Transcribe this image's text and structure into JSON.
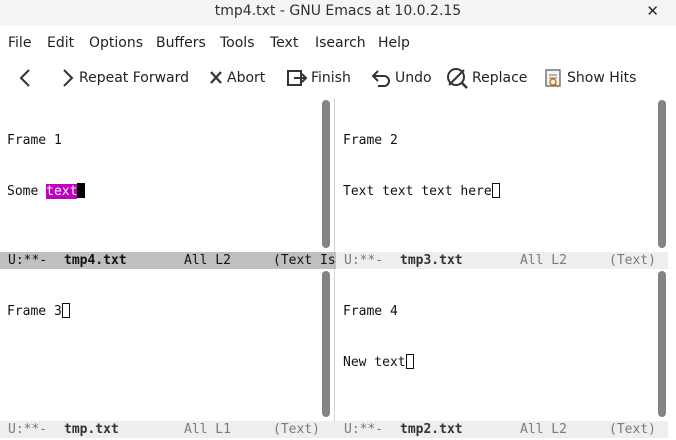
{
  "window": {
    "title": "tmp4.txt - GNU Emacs at 10.0.2.15",
    "close_glyph": "✕"
  },
  "menu": [
    "File",
    "Edit",
    "Options",
    "Buffers",
    "Tools",
    "Text",
    "Isearch",
    "Help"
  ],
  "toolbar": {
    "back_icon": "chevron-left-icon",
    "repeat_forward": "Repeat Forward",
    "abort": "Abort",
    "finish": "Finish",
    "undo": "Undo",
    "replace": "Replace",
    "show_hits": "Show Hits"
  },
  "frames": {
    "f1": {
      "line1": "Frame 1",
      "line2_prefix": "Some ",
      "line2_match": "text"
    },
    "f2": {
      "line1": "Frame 2",
      "line2": "Text text text here"
    },
    "f3": {
      "line1": "Frame 3"
    },
    "f4": {
      "line1": "Frame 4",
      "line2": "New text"
    }
  },
  "modelines": {
    "f1": {
      "status": "U:**-",
      "buffer": "tmp4.txt",
      "position": "All L2",
      "mode": "(Text Is"
    },
    "f2": {
      "status": "U:**-",
      "buffer": "tmp3.txt",
      "position": "All L2",
      "mode": "(Text)"
    },
    "f3": {
      "status": "U:**-",
      "buffer": "tmp.txt",
      "position": "All L1",
      "mode": "(Text)"
    },
    "f4": {
      "status": "U:**-",
      "buffer": "tmp2.txt",
      "position": "All L2",
      "mode": "(Text)"
    }
  },
  "colors": {
    "isearch_highlight": "#c000c0",
    "modeline_active": "#bfbfbf",
    "modeline_inactive": "#eeeeee"
  }
}
